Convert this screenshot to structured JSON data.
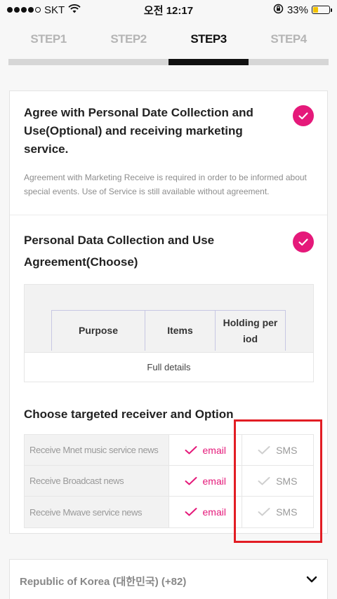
{
  "status_bar": {
    "carrier": "SKT",
    "time": "오전 12:17",
    "battery_percent": "33%",
    "signal_bars_filled": 4,
    "battery_level": 0.33
  },
  "steps": [
    {
      "label": "STEP1",
      "active": false
    },
    {
      "label": "STEP2",
      "active": false
    },
    {
      "label": "STEP3",
      "active": true
    },
    {
      "label": "STEP4",
      "active": false
    }
  ],
  "marketing": {
    "title": "Agree with Personal Date Collection and Use(Optional) and receiving marketing service.",
    "description": "Agreement with Marketing Receive is required in order to be informed about special events. Use of Service is still available without agreement.",
    "checked": true
  },
  "data_collection": {
    "title": "Personal Data Collection and Use Agreement(Choose)",
    "checked": true,
    "table_headers": [
      "Purpose",
      "Items",
      "Holding per iod"
    ],
    "full_details_label": "Full details"
  },
  "receiver": {
    "title": "Choose targeted receiver and Option",
    "rows": [
      {
        "label": "Receive Mnet music service news",
        "email": "email",
        "sms": "SMS",
        "email_checked": true,
        "sms_checked": false
      },
      {
        "label": "Receive Broadcast news",
        "email": "email",
        "sms": "SMS",
        "email_checked": true,
        "sms_checked": false
      },
      {
        "label": "Receive Mwave service news",
        "email": "email",
        "sms": "SMS",
        "email_checked": true,
        "sms_checked": false
      }
    ]
  },
  "country": {
    "selected": "Republic of Korea (대한민국) (+82)"
  },
  "colors": {
    "accent": "#e5197a",
    "highlight_box": "#e21d24"
  }
}
